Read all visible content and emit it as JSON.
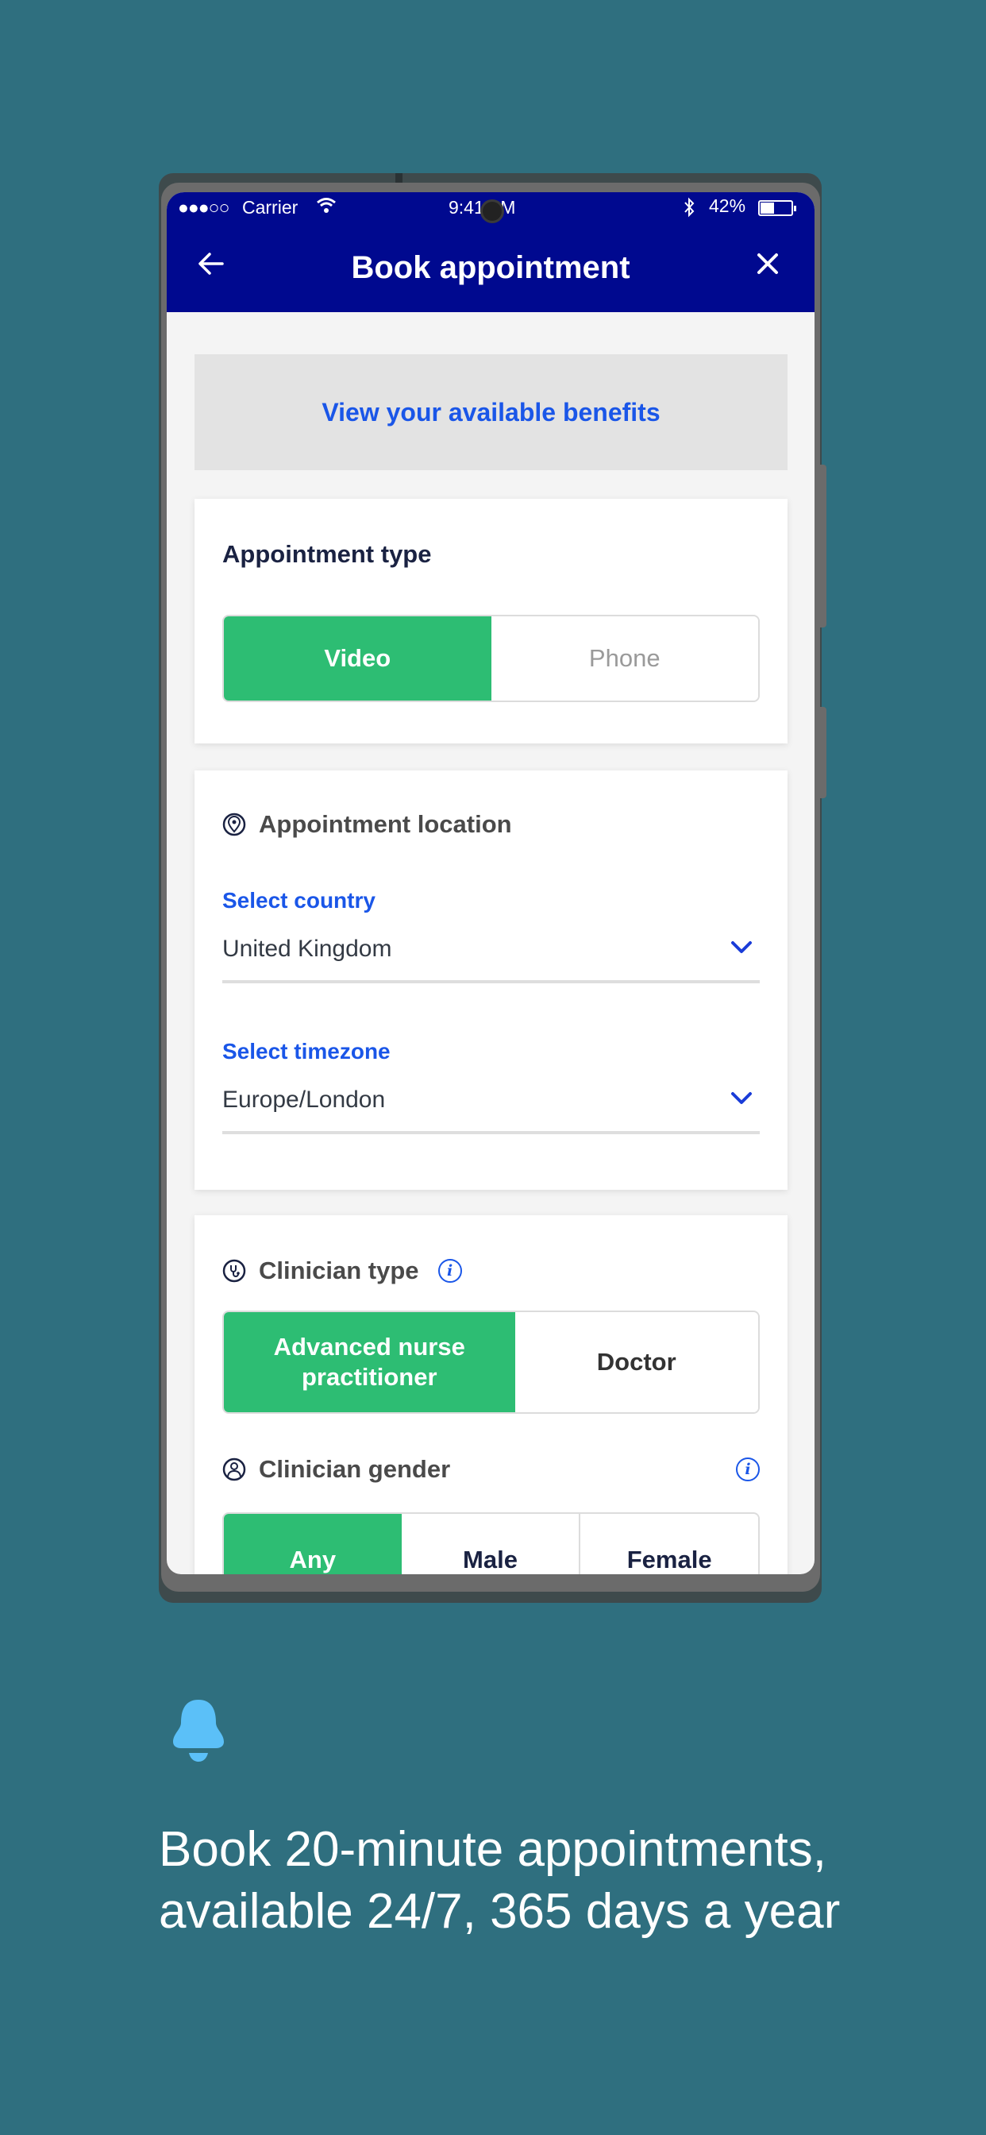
{
  "status_bar": {
    "signal": "●●●○○",
    "carrier": "Carrier",
    "time": "9:41 AM",
    "battery_percent": "42%",
    "battery_level": 0.42
  },
  "header": {
    "back_icon": "arrow-left-icon",
    "title": "Book appointment",
    "close_icon": "close-icon"
  },
  "benefits_link": "View your available benefits",
  "appointment_type": {
    "title": "Appointment type",
    "options": [
      "Video",
      "Phone"
    ],
    "selected": "Video"
  },
  "appointment_location": {
    "title": "Appointment location",
    "icon": "location-pin-icon",
    "country": {
      "label": "Select country",
      "value": "United Kingdom"
    },
    "timezone": {
      "label": "Select timezone",
      "value": "Europe/London"
    }
  },
  "clinician_type": {
    "title": "Clinician type",
    "icon": "stethoscope-icon",
    "options": [
      "Advanced nurse practitioner",
      "Doctor"
    ],
    "selected": "Advanced nurse practitioner"
  },
  "clinician_gender": {
    "title": "Clinician gender",
    "icon": "user-icon",
    "options": [
      "Any",
      "Male",
      "Female"
    ],
    "selected": "Any"
  },
  "promo": {
    "icon": "bell-icon",
    "tagline": "Book 20-minute appointments, available 24/7, 365 days a year"
  },
  "colors": {
    "background": "#2f6f7f",
    "header": "#00098f",
    "accent_green": "#2dbd73",
    "link_blue": "#1a56e8",
    "bell": "#5bc0f8"
  }
}
